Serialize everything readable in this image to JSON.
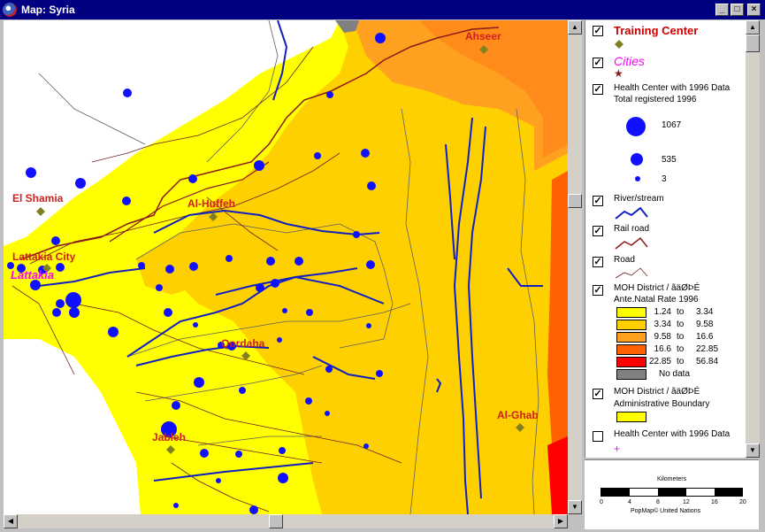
{
  "window": {
    "title": "Map: Syria",
    "buttons": [
      "_",
      "□",
      "×"
    ]
  },
  "map": {
    "place_labels": [
      "Ahseer",
      "El Shamia",
      "Al-Huffeh",
      "Lattakia City",
      "Lattakia",
      "Qordaha",
      "Al-Ghab",
      "Jableh"
    ]
  },
  "legend": {
    "training_center": {
      "label": "Training Center",
      "checked": true,
      "color": "#cc0000"
    },
    "cities": {
      "label": "Cities",
      "checked": true,
      "color": "#ff00ff"
    },
    "health_center": {
      "label": "Health Center with 1996 Data",
      "sublabel": "Total registered 1996",
      "checked": true,
      "sizes": [
        "1067",
        "535",
        "3"
      ]
    },
    "river": {
      "label": "River/stream",
      "checked": true
    },
    "railroad": {
      "label": "Rail road",
      "checked": true
    },
    "road": {
      "label": "Road",
      "checked": true
    },
    "district_rate": {
      "label": "MOH District / ãäØÞÉ",
      "sublabel": "Ante.Natal Rate 1996",
      "checked": true,
      "classes": [
        {
          "from": "1.24",
          "to_word": "to",
          "to": "3.34",
          "color": "#ffff00"
        },
        {
          "from": "3.34",
          "to_word": "to",
          "to": "9.58",
          "color": "#ffd000"
        },
        {
          "from": "9.58",
          "to_word": "to",
          "to": "16.6",
          "color": "#ffa020"
        },
        {
          "from": "16.6",
          "to_word": "to",
          "to": "22.85",
          "color": "#ff6000"
        },
        {
          "from": "22.85",
          "to_word": "to",
          "to": "56.84",
          "color": "#ff0000"
        }
      ],
      "nodata": {
        "label": "No data",
        "color": "#808080"
      }
    },
    "district_admin": {
      "label": "MOH District / ãäØÞÉ",
      "sublabel": "Administrative Boundary",
      "checked": true
    },
    "health_center_plain": {
      "label": "Health Center with 1996 Data",
      "checked": false,
      "symbol": "+"
    }
  },
  "scalebar": {
    "title": "Kilometers",
    "ticks": [
      "0",
      "4",
      "8",
      "12",
      "16",
      "20"
    ],
    "credit": "PopMap© United Nations"
  }
}
